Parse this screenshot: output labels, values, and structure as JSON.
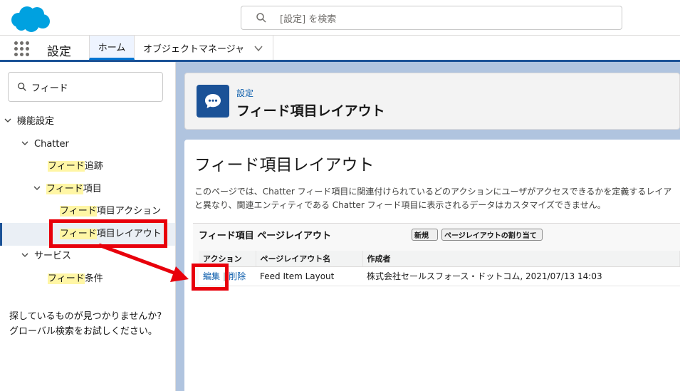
{
  "header": {
    "search_placeholder": "[設定] を検索",
    "brand_color": "#00a1e0"
  },
  "appnav": {
    "app_name": "設定",
    "tabs": [
      {
        "label": "ホーム",
        "active": true
      },
      {
        "label": "オブジェクトマネージャ",
        "active": false
      }
    ]
  },
  "sidebar": {
    "quickfind_value": "フィード",
    "tree": {
      "root": "機能設定",
      "chatter": "Chatter",
      "feed_tracking_hl": "フィード",
      "feed_tracking_rest": "追跡",
      "feed_item_hl": "フィード",
      "feed_item_rest": "項目",
      "feed_item_action_hl": "フィード",
      "feed_item_action_rest": "項目アクション",
      "feed_item_layout_hl": "フィード",
      "feed_item_layout_rest": "項目レイアウト",
      "service": "サービス",
      "feed_condition_hl": "フィード",
      "feed_condition_rest": "条件"
    },
    "not_found_line1": "探しているものが見つかりませんか?",
    "not_found_line2": "グローバル検索をお試しください。"
  },
  "pageheader": {
    "breadcrumb": "設定",
    "title": "フィード項目レイアウト"
  },
  "main": {
    "title": "フィード項目レイアウト",
    "description_line1": "このページでは、Chatter フィード項目に関連付けられているどのアクションにユーザがアクセスできるかを定義するレイア",
    "description_line2": "と異なり、関連エンティティである Chatter フィード項目に表示されるデータはカスタマイズできません。",
    "related_list": {
      "title": "フィード項目 ページレイアウト",
      "new_button": "新規",
      "assign_button": "ページレイアウトの割り当て",
      "columns": [
        "アクション",
        "ページレイアウト名",
        "作成者"
      ],
      "rows": [
        {
          "edit": "編集",
          "separator": "|",
          "delete": "削除",
          "name": "Feed Item Layout",
          "created_by": "株式会社セールスフォース・ドットコム, 2021/07/13 14:03"
        }
      ]
    }
  },
  "annotation_color": "#e8000b"
}
